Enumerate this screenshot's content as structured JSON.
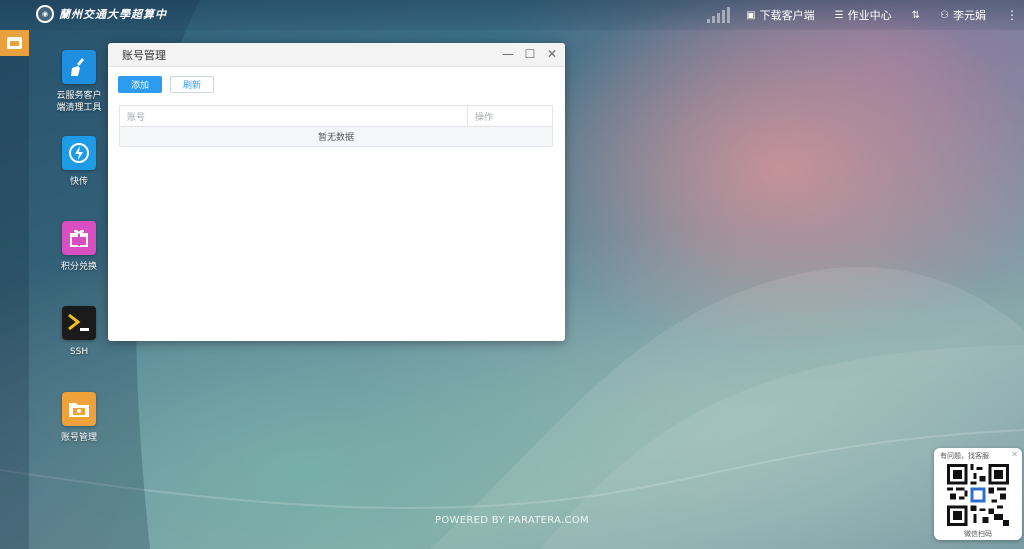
{
  "topbar": {
    "logo_text": "蘭州交通大學超算中",
    "nav": {
      "download": "下载客户端",
      "jobs": "作业中心",
      "user": "李元娟"
    }
  },
  "desktop": {
    "icons": [
      {
        "label_line1": "云服务客户",
        "label_line2": "端清理工具",
        "color": "#1f8fe0"
      },
      {
        "label_line1": "快传",
        "label_line2": "",
        "color": "#1e9be6"
      },
      {
        "label_line1": "积分兑换",
        "label_line2": "",
        "color": "#d84fc2"
      },
      {
        "label_line1": "SSH",
        "label_line2": "",
        "color": "#1b1b1b"
      },
      {
        "label_line1": "账号管理",
        "label_line2": "",
        "color": "#f0a13a"
      }
    ]
  },
  "window": {
    "title": "账号管理",
    "add_button": "添加",
    "refresh_button": "刷新",
    "columns": [
      "账号",
      "操作"
    ],
    "empty_text": "暂无数据"
  },
  "footer": {
    "powered": "POWERED BY PARATERA.COM"
  },
  "qr_widget": {
    "top_text": "有问题，找客服",
    "bottom_text": "微信扫码"
  }
}
